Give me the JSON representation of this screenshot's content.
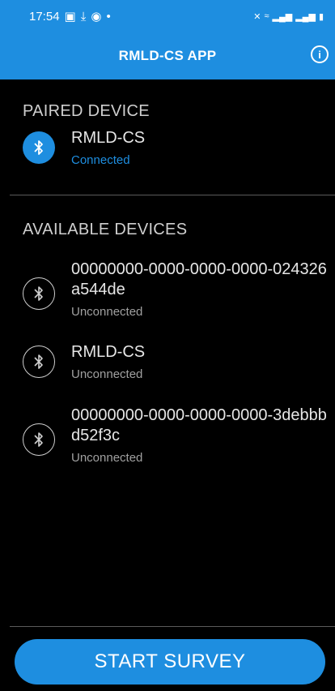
{
  "status_bar": {
    "time": "17:54",
    "left_icons": [
      "gallery-icon",
      "download-icon",
      "location-icon",
      "dot-icon"
    ],
    "right_icons": [
      "mute-icon",
      "wifi-icon",
      "signal-icon",
      "signal-icon",
      "battery-icon"
    ]
  },
  "app_bar": {
    "title": "RMLD-CS APP",
    "info_icon": "info-icon"
  },
  "paired": {
    "header": "PAIRED DEVICE",
    "device": {
      "name": "RMLD-CS",
      "status": "Connected"
    }
  },
  "available": {
    "header": "AVAILABLE DEVICES",
    "devices": [
      {
        "name": "00000000-0000-0000-0000-024326a544de",
        "status": "Unconnected"
      },
      {
        "name": "RMLD-CS",
        "status": "Unconnected"
      },
      {
        "name": "00000000-0000-0000-0000-3debbbd52f3c",
        "status": "Unconnected"
      }
    ]
  },
  "actions": {
    "start_label": "START SURVEY"
  },
  "colors": {
    "accent": "#1e8ee0",
    "background": "#000000"
  }
}
